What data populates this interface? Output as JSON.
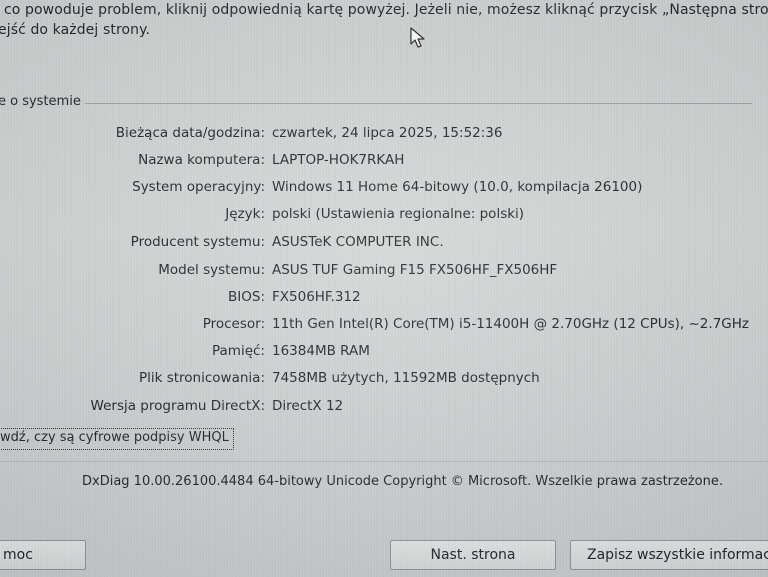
{
  "intro": {
    "line1": "co powoduje problem, kliknij odpowiednią kartę powyżej. Jeżeli nie, możesz kliknąć przycisk „Następna strona” por",
    "line2": "ejść do każdej strony."
  },
  "group": {
    "title": "e o systemie"
  },
  "system_info": [
    {
      "label": "Bieżąca data/godzina:",
      "value": "czwartek, 24 lipca 2025, 15:52:36"
    },
    {
      "label": "Nazwa komputera:",
      "value": "LAPTOP-HOK7RKAH"
    },
    {
      "label": "System operacyjny:",
      "value": "Windows 11 Home 64-bitowy (10.0, kompilacja 26100)"
    },
    {
      "label": "Język:",
      "value": "polski (Ustawienia regionalne: polski)"
    },
    {
      "label": "Producent systemu:",
      "value": "ASUSTeK COMPUTER INC."
    },
    {
      "label": "Model systemu:",
      "value": "ASUS TUF Gaming F15 FX506HF_FX506HF"
    },
    {
      "label": "BIOS:",
      "value": "FX506HF.312"
    },
    {
      "label": "Procesor:",
      "value": "11th Gen Intel(R) Core(TM) i5-11400H @ 2.70GHz (12 CPUs), ~2.7GHz"
    },
    {
      "label": "Pamięć:",
      "value": "16384MB RAM"
    },
    {
      "label": "Plik stronicowania:",
      "value": "7458MB użytych, 11592MB dostępnych"
    },
    {
      "label": "Wersja programu DirectX:",
      "value": "DirectX 12"
    }
  ],
  "whql_checkbox": {
    "label": "wdź, czy są cyfrowe podpisy WHQL"
  },
  "footer": {
    "text": "DxDiag 10.00.26100.4484 64-bitowy Unicode  Copyright © Microsoft. Wszelkie prawa zastrzeżone."
  },
  "buttons": {
    "help": "moc",
    "next": "Nast. strona",
    "save": "Zapisz wszystkie informacje..."
  }
}
